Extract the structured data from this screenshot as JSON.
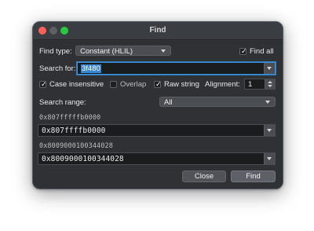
{
  "window": {
    "title": "Find"
  },
  "find_type": {
    "label": "Find type:",
    "value": "Constant (HLIL)"
  },
  "find_all": {
    "label": "Find all",
    "checked": true
  },
  "search_for": {
    "label": "Search for:",
    "value": "3f480"
  },
  "options": {
    "case_insensitive": {
      "label": "Case insensitive",
      "checked": true
    },
    "overlap": {
      "label": "Overlap",
      "checked": false
    },
    "raw_string": {
      "label": "Raw string",
      "checked": true
    },
    "alignment": {
      "label": "Alignment:",
      "value": "1"
    }
  },
  "search_range": {
    "label": "Search range:",
    "value": "All"
  },
  "range_start": {
    "caption": "0x807fffffb0000",
    "value": "0x807ffffb0000"
  },
  "range_end": {
    "caption": "0x8009000100344028",
    "value": "0x8009000100344028"
  },
  "buttons": {
    "close": "Close",
    "find": "Find"
  }
}
